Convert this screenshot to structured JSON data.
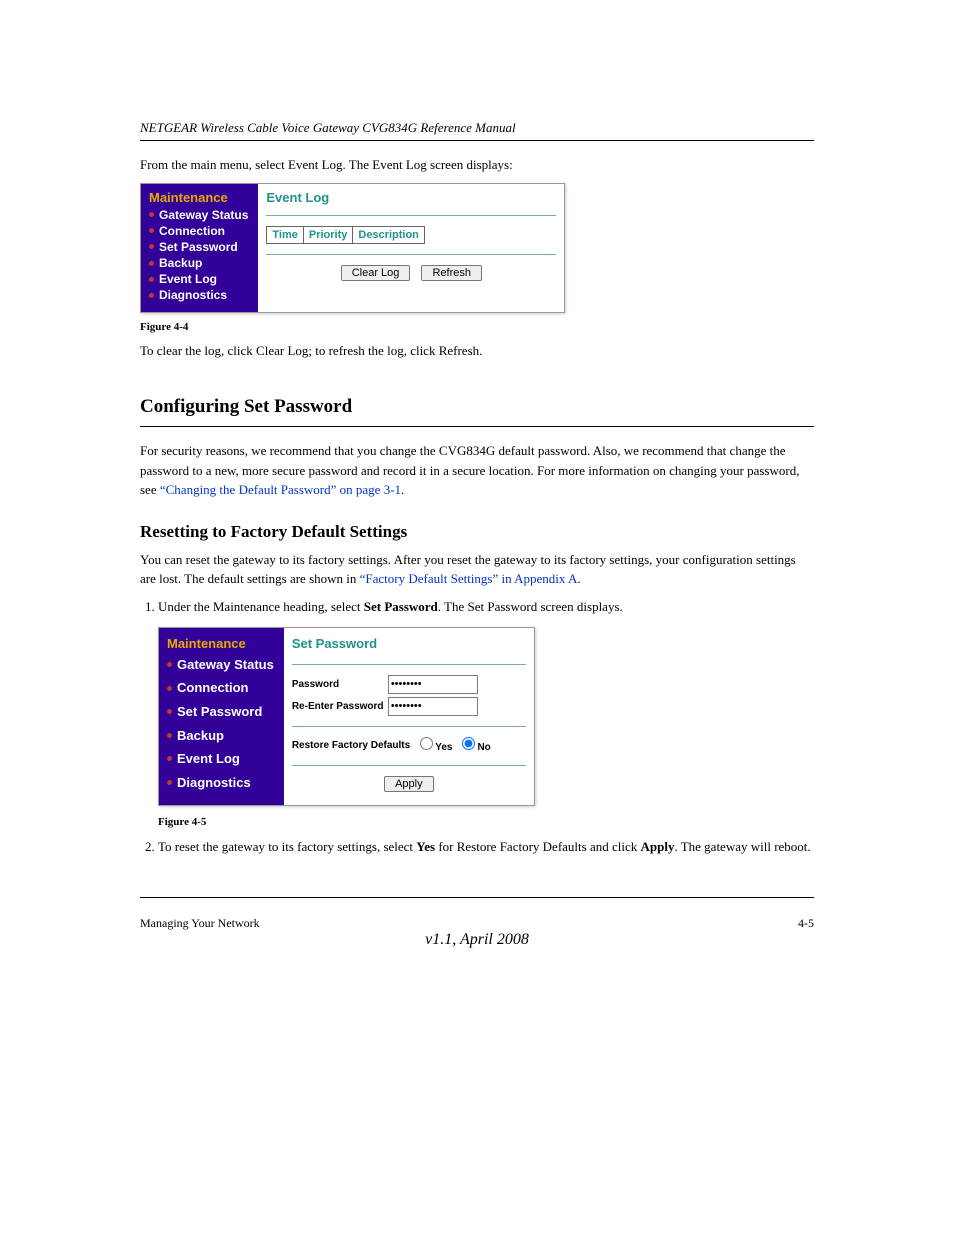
{
  "running_header": "NETGEAR Wireless Cable Voice Gateway CVG834G Reference Manual",
  "intro_paragraph": "From the main menu, select Event Log. The Event Log screen displays:",
  "sidebar": {
    "heading": "Maintenance",
    "items": [
      "Gateway Status",
      "Connection",
      "Set Password",
      "Backup",
      "Event Log",
      "Diagnostics"
    ]
  },
  "eventlog_panel": {
    "title": "Event Log",
    "columns": [
      "Time",
      "Priority",
      "Description"
    ],
    "buttons": {
      "clear": "Clear Log",
      "refresh": "Refresh"
    }
  },
  "figure_caption_1": "Figure 4-4",
  "paragraph_after_fig1": "To clear the log, click Clear Log; to refresh the log, click Refresh.",
  "section_heading": "Configuring Set Password",
  "section_para_1_prefix": "For security reasons, we recommend that you change the CVG834G default password. Also, we recommend that change the password to a new, more secure password and record it in a secure location. For more information on changing your password, see ",
  "section_link_text_1": "“Changing the Default Password” on page 3-1",
  "section_para_1_suffix": ".",
  "sub_heading": "Resetting to Factory Default Settings",
  "sub_para_prefix": "You can reset the gateway to its factory settings. After you reset the gateway to its factory settings, your configuration settings are lost. The default settings are shown in ",
  "sub_link_text": "“Factory Default Settings” in Appendix A",
  "sub_para_suffix": ".",
  "steps": [
    {
      "text_before": "Under the Maintenance heading, select ",
      "bold": "Set Password",
      "text_after": ". The Set Password screen displays."
    }
  ],
  "pwd_panel": {
    "title": "Set Password",
    "labels": {
      "password": "Password",
      "reenter": "Re-Enter Password",
      "restore": "Restore Factory Defaults"
    },
    "values": {
      "password": "********",
      "reenter": "********"
    },
    "options": {
      "yes": "Yes",
      "no": "No"
    },
    "apply": "Apply"
  },
  "figure_caption_2": "Figure 4-5",
  "steps_after": [
    {
      "text_before": "To reset the gateway to its factory settings, select ",
      "bold": "Yes",
      "text_after_bold": " for Restore Factory Defaults and click ",
      "bold2": "Apply",
      "text_end": ". The gateway will reboot."
    }
  ],
  "footer": {
    "left": "Managing Your Network",
    "right": "4-5",
    "rev": "v1.1, April 2008"
  }
}
